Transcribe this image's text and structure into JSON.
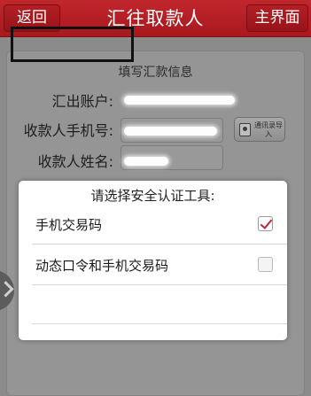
{
  "header": {
    "back_label": "返回",
    "title": "汇往取款人",
    "home_label": "主界面"
  },
  "form": {
    "section_title": "填写汇款信息",
    "account_label": "汇出账户:",
    "phone_label": "收款人手机号:",
    "name_label": "收款人姓名:",
    "contacts_button_label": "通讯录导入"
  },
  "dialog": {
    "title": "请选择安全认证工具:",
    "options": [
      {
        "label": "手机交易码",
        "checked": true
      },
      {
        "label": "动态口令和手机交易码",
        "checked": false
      }
    ]
  },
  "colors": {
    "accent": "#c0272d",
    "overlay": "#8b8b8b"
  }
}
